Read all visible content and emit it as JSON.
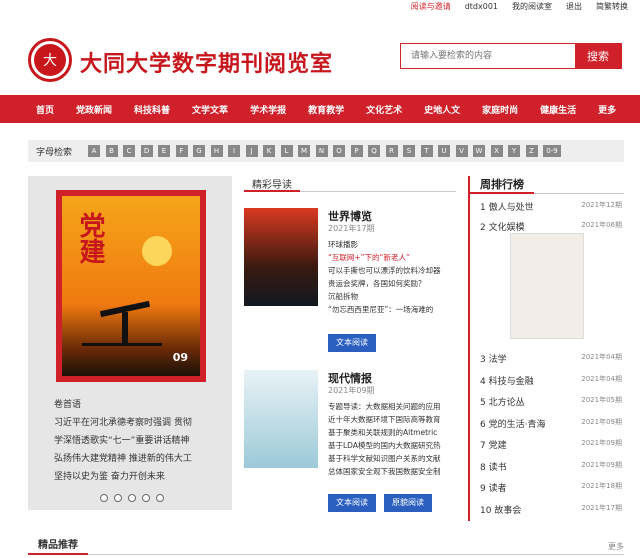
{
  "topbar": {
    "read_record": "阅读与邀请",
    "user": "dtdx001",
    "my_reading": "我的阅读室",
    "logout": "退出",
    "switch": "简繁转换"
  },
  "header": {
    "logo_text": "大",
    "title": "大同大学数字期刊阅览室",
    "search_placeholder": "请输入要检索的内容",
    "search_button": "搜索"
  },
  "nav": [
    "首页",
    "党政新闻",
    "科技科普",
    "文学文萃",
    "学术学报",
    "教育教学",
    "文化艺术",
    "史地人文",
    "家庭时尚",
    "健康生活",
    "更多"
  ],
  "alpha": {
    "label": "字母检索",
    "letters": [
      "A",
      "B",
      "C",
      "D",
      "E",
      "F",
      "G",
      "H",
      "I",
      "J",
      "K",
      "L",
      "M",
      "N",
      "O",
      "P",
      "Q",
      "R",
      "S",
      "T",
      "U",
      "V",
      "W",
      "X",
      "Y",
      "Z",
      "0-9"
    ]
  },
  "featured": {
    "cover_title": "党建",
    "cover_num": "09",
    "issue_label": "卷首语",
    "lines": [
      "习近平在河北承德考察时强调 贯彻",
      "学深悟透歌实“七一”重要讲话精神",
      "弘扬伟大建党精神 推进新的伟大工",
      "坚持以史为鉴 奋力开创未来"
    ]
  },
  "guide": {
    "title": "精彩导读",
    "items": [
      {
        "title": "世界博览",
        "date": "2021年17期",
        "desc": [
          "环球播影",
          "“互联网+”下的“新老人”",
          "可以手撕也可以漂浮的饮料冷却器",
          "贵运会奖牌，各国如何奖励？",
          "沉船拆物",
          "“勿忘西西里尼亚”：一场海难的"
        ],
        "button": "文本阅读"
      },
      {
        "title": "现代情报",
        "date": "2021年09期",
        "desc": [
          "专题导读：大数据相关问题的应用",
          "近十年大数据环境下国际高等教育",
          "基于聚类和关联规则的Altmetric",
          "基于LDA模型的国内大数据研究热",
          "基于科学文献知识图户关系的文献",
          "总体国家安全观下我国数据安全制"
        ],
        "button": "文本阅读",
        "button2": "原貌阅读"
      }
    ]
  },
  "rank": {
    "title": "周排行榜",
    "items": [
      {
        "n": "1",
        "name": "傲人与处世",
        "date": "2021年12期"
      },
      {
        "n": "2",
        "name": "文化娱模",
        "date": "2021年06期"
      },
      {
        "n": "3",
        "name": "法学",
        "date": "2021年04期"
      },
      {
        "n": "4",
        "name": "科技与金融",
        "date": "2021年04期"
      },
      {
        "n": "5",
        "name": "北方论丛",
        "date": "2021年05期"
      },
      {
        "n": "6",
        "name": "党的生活·青海",
        "date": "2021年09期"
      },
      {
        "n": "7",
        "name": "党建",
        "date": "2021年09期"
      },
      {
        "n": "8",
        "name": "读书",
        "date": "2021年09期"
      },
      {
        "n": "9",
        "name": "读者",
        "date": "2021年18期"
      },
      {
        "n": "10",
        "name": "故事会",
        "date": "2021年17期"
      }
    ]
  },
  "bottom": {
    "title": "精品推荐",
    "more": "更多"
  }
}
